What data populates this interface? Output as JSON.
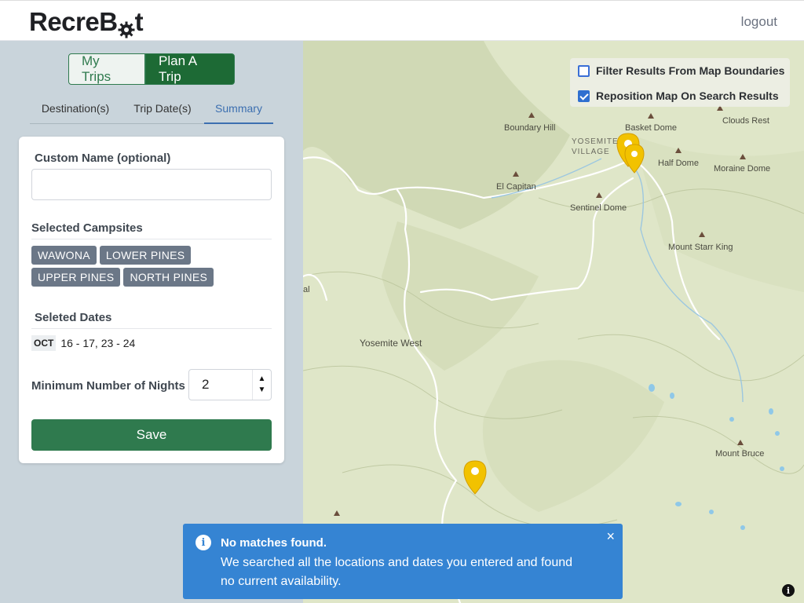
{
  "header": {
    "brand_prefix": "RecreB",
    "brand_suffix": "t",
    "logout": "logout"
  },
  "sidebar": {
    "segments": [
      "My Trips",
      "Plan A Trip"
    ],
    "tabs": [
      "Destination(s)",
      "Trip Date(s)",
      "Summary"
    ],
    "active_tab": "Summary",
    "custom_name_label": "Custom Name (optional)",
    "custom_name_value": "",
    "selected_campsites_label": "Selected Campsites",
    "campsites": [
      "WAWONA",
      "LOWER PINES",
      "UPPER PINES",
      "NORTH PINES"
    ],
    "selected_dates_label": "Seleted Dates",
    "month": "OCT",
    "date_ranges": "16 - 17, 23 - 24",
    "min_nights_label": "Minimum Number of Nights",
    "min_nights_value": "2",
    "save_label": "Save"
  },
  "map": {
    "filter_label": "Filter Results From Map Boundaries",
    "filter_checked": false,
    "reposition_label": "Reposition Map On Search Results",
    "reposition_checked": true,
    "labels": {
      "boundary_hill": "Boundary Hill",
      "basket_dome": "Basket Dome",
      "clouds_rest": "Clouds Rest",
      "yosemite_village": "YOSEMITE VILLAGE",
      "half_dome": "Half Dome",
      "moraine_dome": "Moraine Dome",
      "el_capitan": "El Capitan",
      "sentinel_dome": "Sentinel Dome",
      "mount_starr_king": "Mount Starr King",
      "yosemite_west": "Yosemite West",
      "mount_bruce": "Mount Bruce",
      "al": "al",
      "info": "i"
    },
    "colors": {
      "map_bg": "#dfe6c8",
      "pin": "#f2c200",
      "water": "#8fc8e8"
    }
  },
  "toast": {
    "title": "No matches found.",
    "message": "We searched all the locations and dates you entered and found no current availability.",
    "close": "×",
    "icon": "i"
  }
}
